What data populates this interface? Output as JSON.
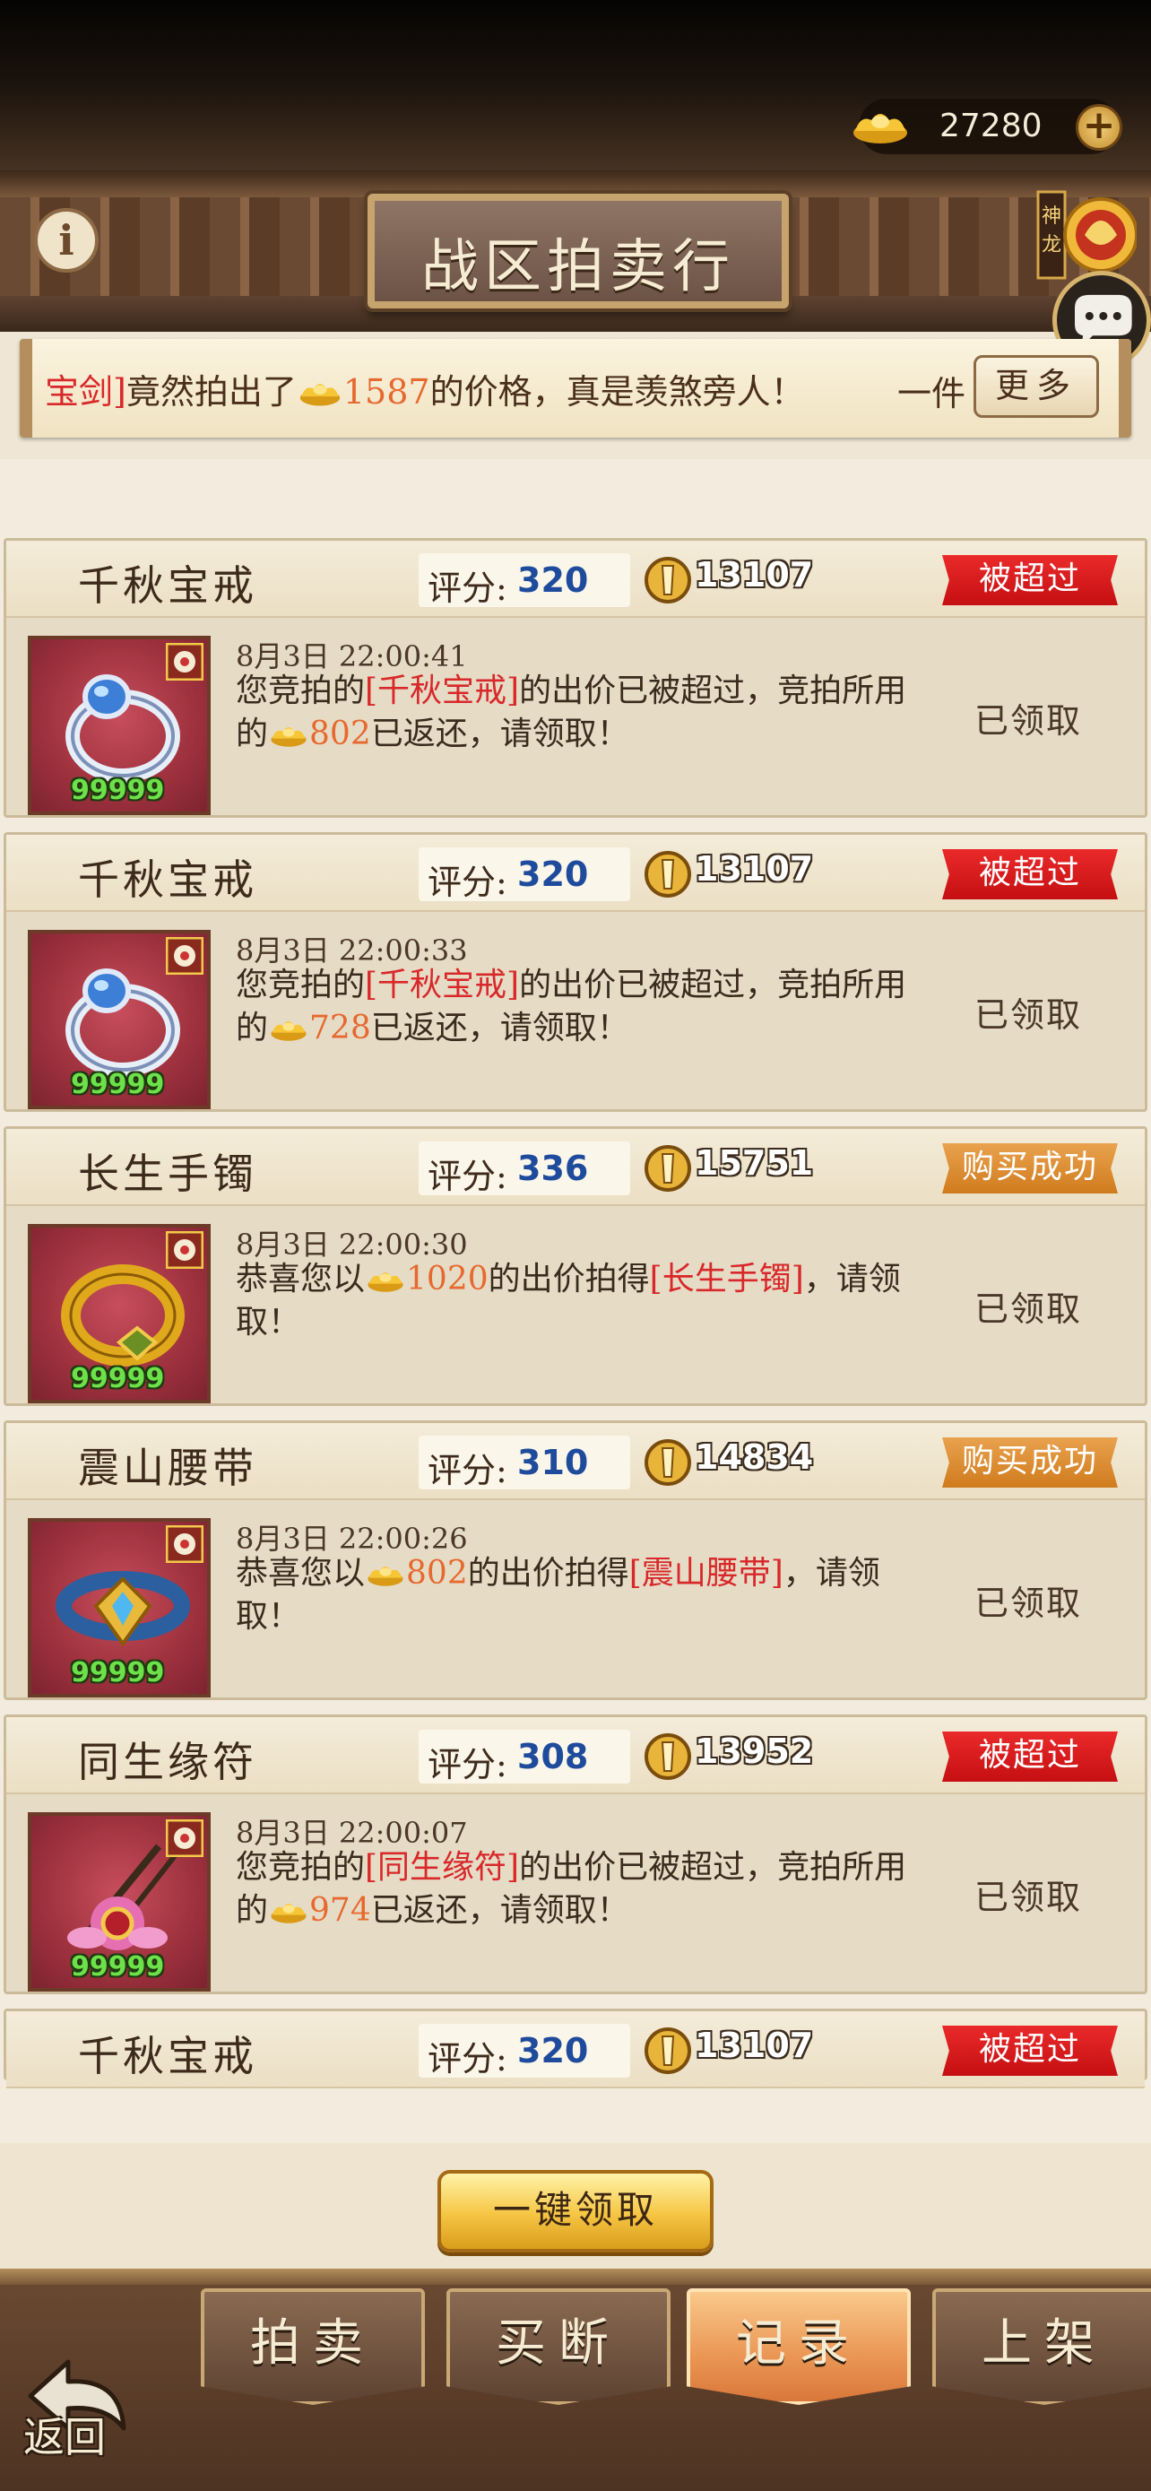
{
  "header": {
    "title": "战区拍卖行",
    "gold_amount": "27280",
    "info_label": "i",
    "dragon_badge_text": "神龙"
  },
  "marquee": {
    "item_fragment": "宝剑]",
    "text_before_price": "竟然拍出了",
    "price": "1587",
    "text_after_price": "的价格，真是羡煞旁人！",
    "extra": "一件",
    "more_label": "更多"
  },
  "records": [
    {
      "name": "千秋宝戒",
      "score_label": "评分:",
      "score": "320",
      "power": "13107",
      "status": "被超过",
      "status_type": "red",
      "time": "8月3日  22:00:41",
      "msg_pre": "您竞拍的",
      "msg_item": "[千秋宝戒]",
      "msg_mid": "的出价已被超过，竞拍所用的",
      "msg_amount": "802",
      "msg_post": "已返还，请领取！",
      "count": "99999",
      "claimed": "已领取",
      "icon": "ring-icon"
    },
    {
      "name": "千秋宝戒",
      "score_label": "评分:",
      "score": "320",
      "power": "13107",
      "status": "被超过",
      "status_type": "red",
      "time": "8月3日  22:00:33",
      "msg_pre": "您竞拍的",
      "msg_item": "[千秋宝戒]",
      "msg_mid": "的出价已被超过，竞拍所用的",
      "msg_amount": "728",
      "msg_post": "已返还，请领取！",
      "count": "99999",
      "claimed": "已领取",
      "icon": "ring-icon"
    },
    {
      "name": "长生手镯",
      "score_label": "评分:",
      "score": "336",
      "power": "15751",
      "status": "购买成功",
      "status_type": "orange",
      "time": "8月3日  22:00:30",
      "msg_pre": "恭喜您以",
      "msg_amount": "1020",
      "msg_mid": "的出价拍得",
      "msg_item": "[长生手镯]",
      "msg_post": "，请领取！",
      "count": "99999",
      "claimed": "已领取",
      "icon": "bracelet-icon"
    },
    {
      "name": "震山腰带",
      "score_label": "评分:",
      "score": "310",
      "power": "14834",
      "status": "购买成功",
      "status_type": "orange",
      "time": "8月3日  22:00:26",
      "msg_pre": "恭喜您以",
      "msg_amount": "802",
      "msg_mid": "的出价拍得",
      "msg_item": "[震山腰带]",
      "msg_post": "，请领取！",
      "count": "99999",
      "claimed": "已领取",
      "icon": "belt-icon"
    },
    {
      "name": "同生缘符",
      "score_label": "评分:",
      "score": "308",
      "power": "13952",
      "status": "被超过",
      "status_type": "red",
      "time": "8月3日  22:00:07",
      "msg_pre": "您竞拍的",
      "msg_item": "[同生缘符]",
      "msg_mid": "的出价已被超过，竞拍所用的",
      "msg_amount": "974",
      "msg_post": "已返还，请领取！",
      "count": "99999",
      "claimed": "已领取",
      "icon": "talisman-icon"
    },
    {
      "name": "千秋宝戒",
      "score_label": "评分:",
      "score": "320",
      "power": "13107",
      "status": "被超过",
      "status_type": "red"
    }
  ],
  "claim_all_label": "一键领取",
  "tabs": [
    {
      "label": "拍卖"
    },
    {
      "label": "买断"
    },
    {
      "label": "记录"
    },
    {
      "label": "上架"
    }
  ],
  "back_label": "返回",
  "colors": {
    "status_red": "#d8282a",
    "status_orange": "#e08a32",
    "score_blue": "#1f4b9c",
    "price_orange": "#e6692f"
  }
}
